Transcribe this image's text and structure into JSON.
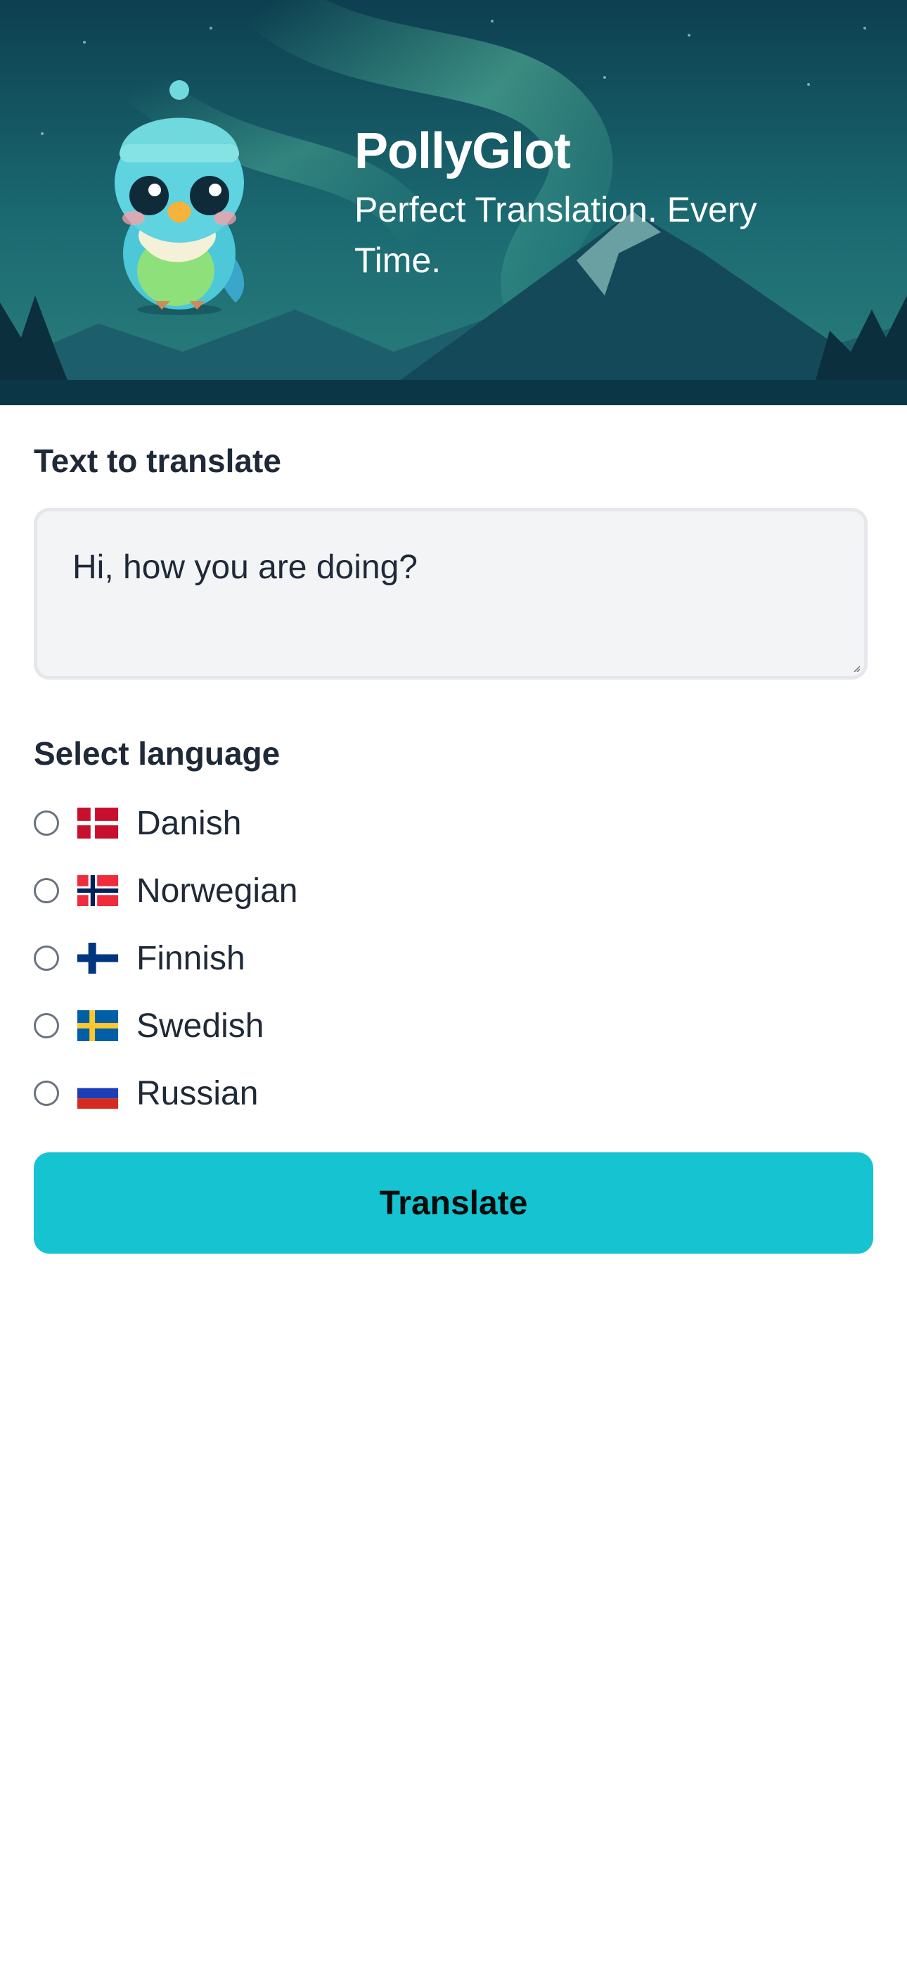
{
  "header": {
    "title": "PollyGlot",
    "tagline": "Perfect Translation. Every Time."
  },
  "input": {
    "label": "Text to translate",
    "value": "Hi, how you are doing?"
  },
  "languages": {
    "label": "Select language",
    "options": [
      {
        "label": "Danish",
        "flag": "flag-denmark-icon"
      },
      {
        "label": "Norwegian",
        "flag": "flag-norway-icon"
      },
      {
        "label": "Finnish",
        "flag": "flag-finland-icon"
      },
      {
        "label": "Swedish",
        "flag": "flag-sweden-icon"
      },
      {
        "label": "Russian",
        "flag": "flag-russia-icon"
      }
    ]
  },
  "actions": {
    "translate_label": "Translate"
  },
  "colors": {
    "accent": "#16c3d1",
    "header_bg": "#0f4a58"
  }
}
